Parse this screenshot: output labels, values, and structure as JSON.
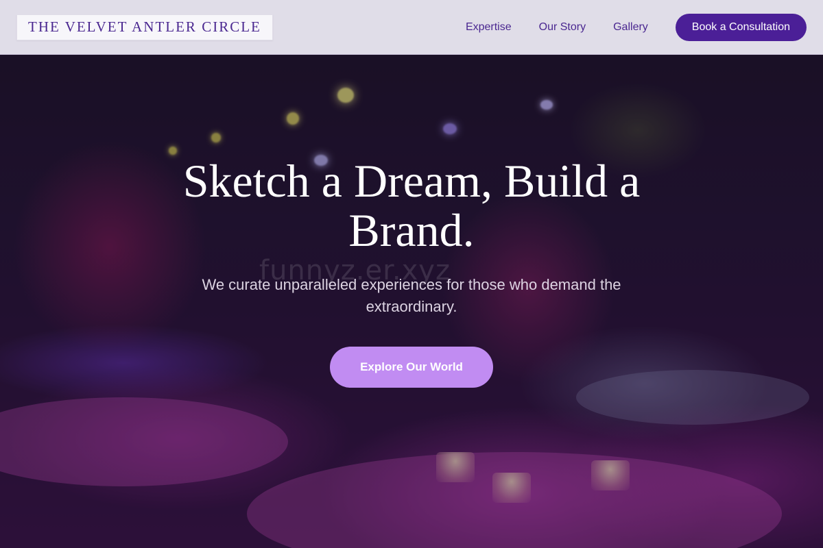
{
  "brand": {
    "name": "THE VELVET ANTLER CIRCLE"
  },
  "nav": {
    "items": [
      {
        "label": "Expertise"
      },
      {
        "label": "Our Story"
      },
      {
        "label": "Gallery"
      }
    ],
    "cta_label": "Book a Consultation"
  },
  "hero": {
    "title": "Sketch a Dream, Build a Brand.",
    "subtitle": "We curate unparalleled experiences for those who demand the extraordinary.",
    "button_label": "Explore Our World",
    "watermark": "funnyz.er.xyz"
  },
  "colors": {
    "brand_purple": "#4b1f97",
    "nav_text": "#4a2790",
    "hero_button": "#c18cf2",
    "header_bg": "#e8e6f0"
  }
}
